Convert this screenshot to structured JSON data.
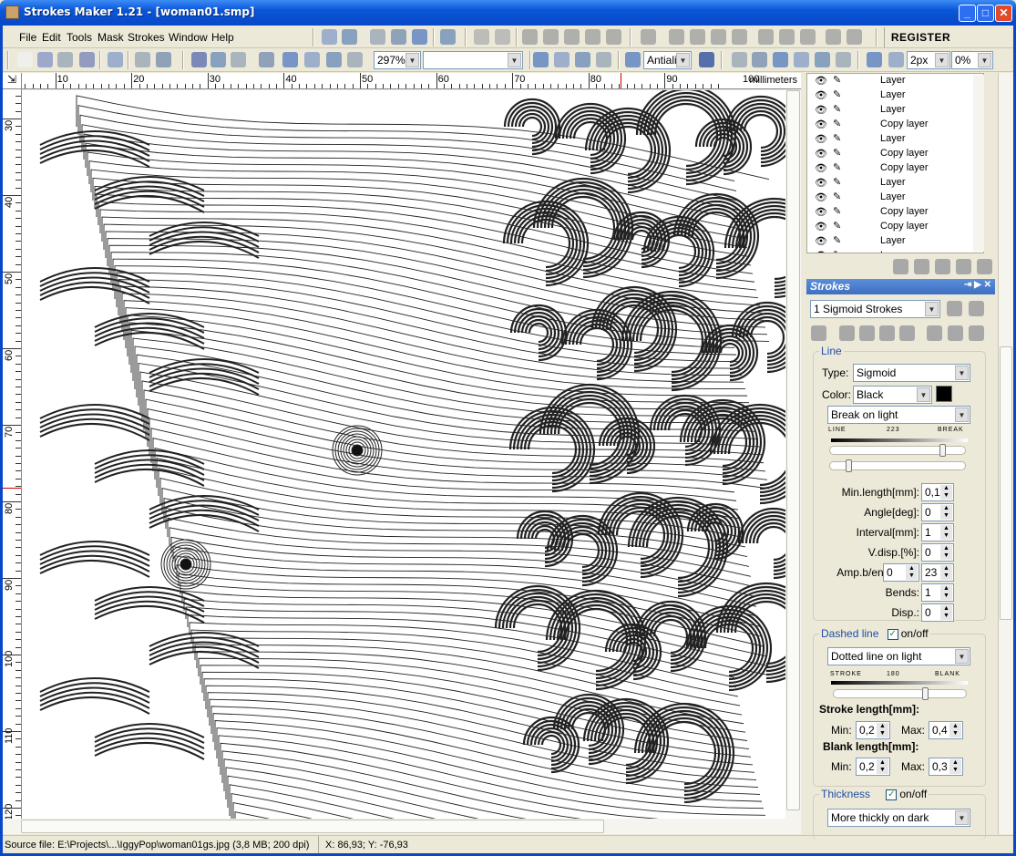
{
  "window": {
    "title": "Strokes Maker 1.21 - [woman01.smp]",
    "minimize": "_",
    "maximize": "□",
    "close": "✕"
  },
  "menu": [
    "File",
    "Edit",
    "Tools",
    "Mask",
    "Strokes",
    "Window",
    "Help"
  ],
  "register_label": "REGISTER",
  "toolbar": {
    "zoom": "297%",
    "layer_select": "",
    "antialias": "Antiali",
    "brush_size": "2px",
    "opacity": "0%"
  },
  "ruler": {
    "unit": "millimeters",
    "top_ticks": [
      "10",
      "20",
      "30",
      "40",
      "50",
      "60",
      "70",
      "80",
      "90",
      "100"
    ],
    "left_ticks": [
      "30",
      "40",
      "50",
      "60",
      "70",
      "80",
      "90",
      "100",
      "110",
      "120"
    ]
  },
  "layers": [
    "Layer",
    "Layer",
    "Layer",
    "Copy layer",
    "Layer",
    "Copy layer",
    "Copy layer",
    "Layer",
    "Layer",
    "Copy layer",
    "Copy layer",
    "Layer",
    "Layer"
  ],
  "strokes_panel": {
    "title": "Strokes",
    "preset": "1 Sigmoid Strokes",
    "line": {
      "legend": "Line",
      "type_label": "Type:",
      "type": "Sigmoid",
      "color_label": "Color:",
      "color": "Black",
      "color_hex": "#000000",
      "mode": "Break on light",
      "scale_left": "LINE",
      "scale_value": "223",
      "scale_right": "BREAK",
      "slider1": 0.85,
      "slider2": 0.12,
      "fields": [
        {
          "label": "Min.length[mm]:",
          "value": "0,1"
        },
        {
          "label": "Angle[deg]:",
          "value": "0"
        },
        {
          "label": "Interval[mm]:",
          "value": "1"
        },
        {
          "label": "V.disp.[%]:",
          "value": "0"
        },
        {
          "label": "Amp.b/en:",
          "value": "0",
          "value2": "23"
        },
        {
          "label": "Bends:",
          "value": "1"
        },
        {
          "label": "Disp.:",
          "value": "0"
        }
      ]
    },
    "dashed": {
      "legend": "Dashed line",
      "toggle": "on/off",
      "checked": true,
      "mode": "Dotted line on light",
      "scale_left": "STROKE",
      "scale_value": "180",
      "scale_right": "BLANK",
      "slider": 0.7,
      "stroke_title": "Stroke length[mm]:",
      "stroke_min_label": "Min:",
      "stroke_min": "0,2",
      "stroke_max_label": "Max:",
      "stroke_max": "0,4",
      "blank_title": "Blank length[mm]:",
      "blank_min_label": "Min:",
      "blank_min": "0,2",
      "blank_max_label": "Max:",
      "blank_max": "0,3"
    },
    "thickness": {
      "legend": "Thickness",
      "toggle": "on/off",
      "checked": true,
      "mode": "More thickly on dark"
    }
  },
  "status": {
    "source": "Source file: E:\\Projects\\...\\IggyPop\\woman01gs.jpg (3,8 MB; 200 dpi)",
    "coords": "X: 86,93; Y: -76,93"
  }
}
